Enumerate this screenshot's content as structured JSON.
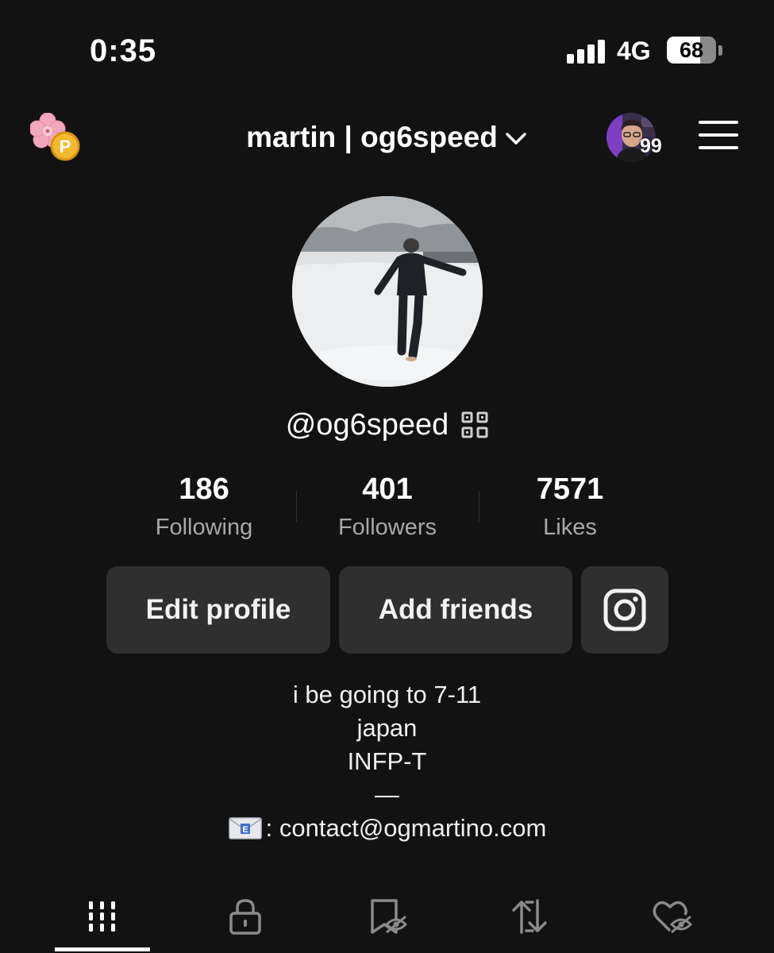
{
  "status_bar": {
    "time": "0:35",
    "network": "4G",
    "battery_percent": "68",
    "battery_level": 0.68
  },
  "header": {
    "account_name": "martin | og6speed",
    "notification_count": "99",
    "left_icon": "cherry-blossom-coin-icon",
    "right_icon": "hamburger-menu-icon"
  },
  "profile": {
    "username": "@og6speed",
    "stats": [
      {
        "value": "186",
        "label": "Following"
      },
      {
        "value": "401",
        "label": "Followers"
      },
      {
        "value": "7571",
        "label": "Likes"
      }
    ]
  },
  "actions": {
    "edit_profile": "Edit profile",
    "add_friends": "Add friends",
    "instagram_icon": "instagram-icon"
  },
  "bio": {
    "line1": "i be going to 7-11",
    "line2": "japan",
    "line3": "INFP-T",
    "line4": "—",
    "contact_email": ": contact@ogmartino.com"
  },
  "tabs": [
    {
      "icon": "grid-icon",
      "selected": true
    },
    {
      "icon": "lock-icon",
      "selected": false
    },
    {
      "icon": "bookmark-hidden-icon",
      "selected": false
    },
    {
      "icon": "repost-icon",
      "selected": false
    },
    {
      "icon": "heart-hidden-icon",
      "selected": false
    }
  ],
  "colors": {
    "background": "#121212",
    "button_bg": "#2f2f2f",
    "secondary_text": "#a8a8a8"
  }
}
